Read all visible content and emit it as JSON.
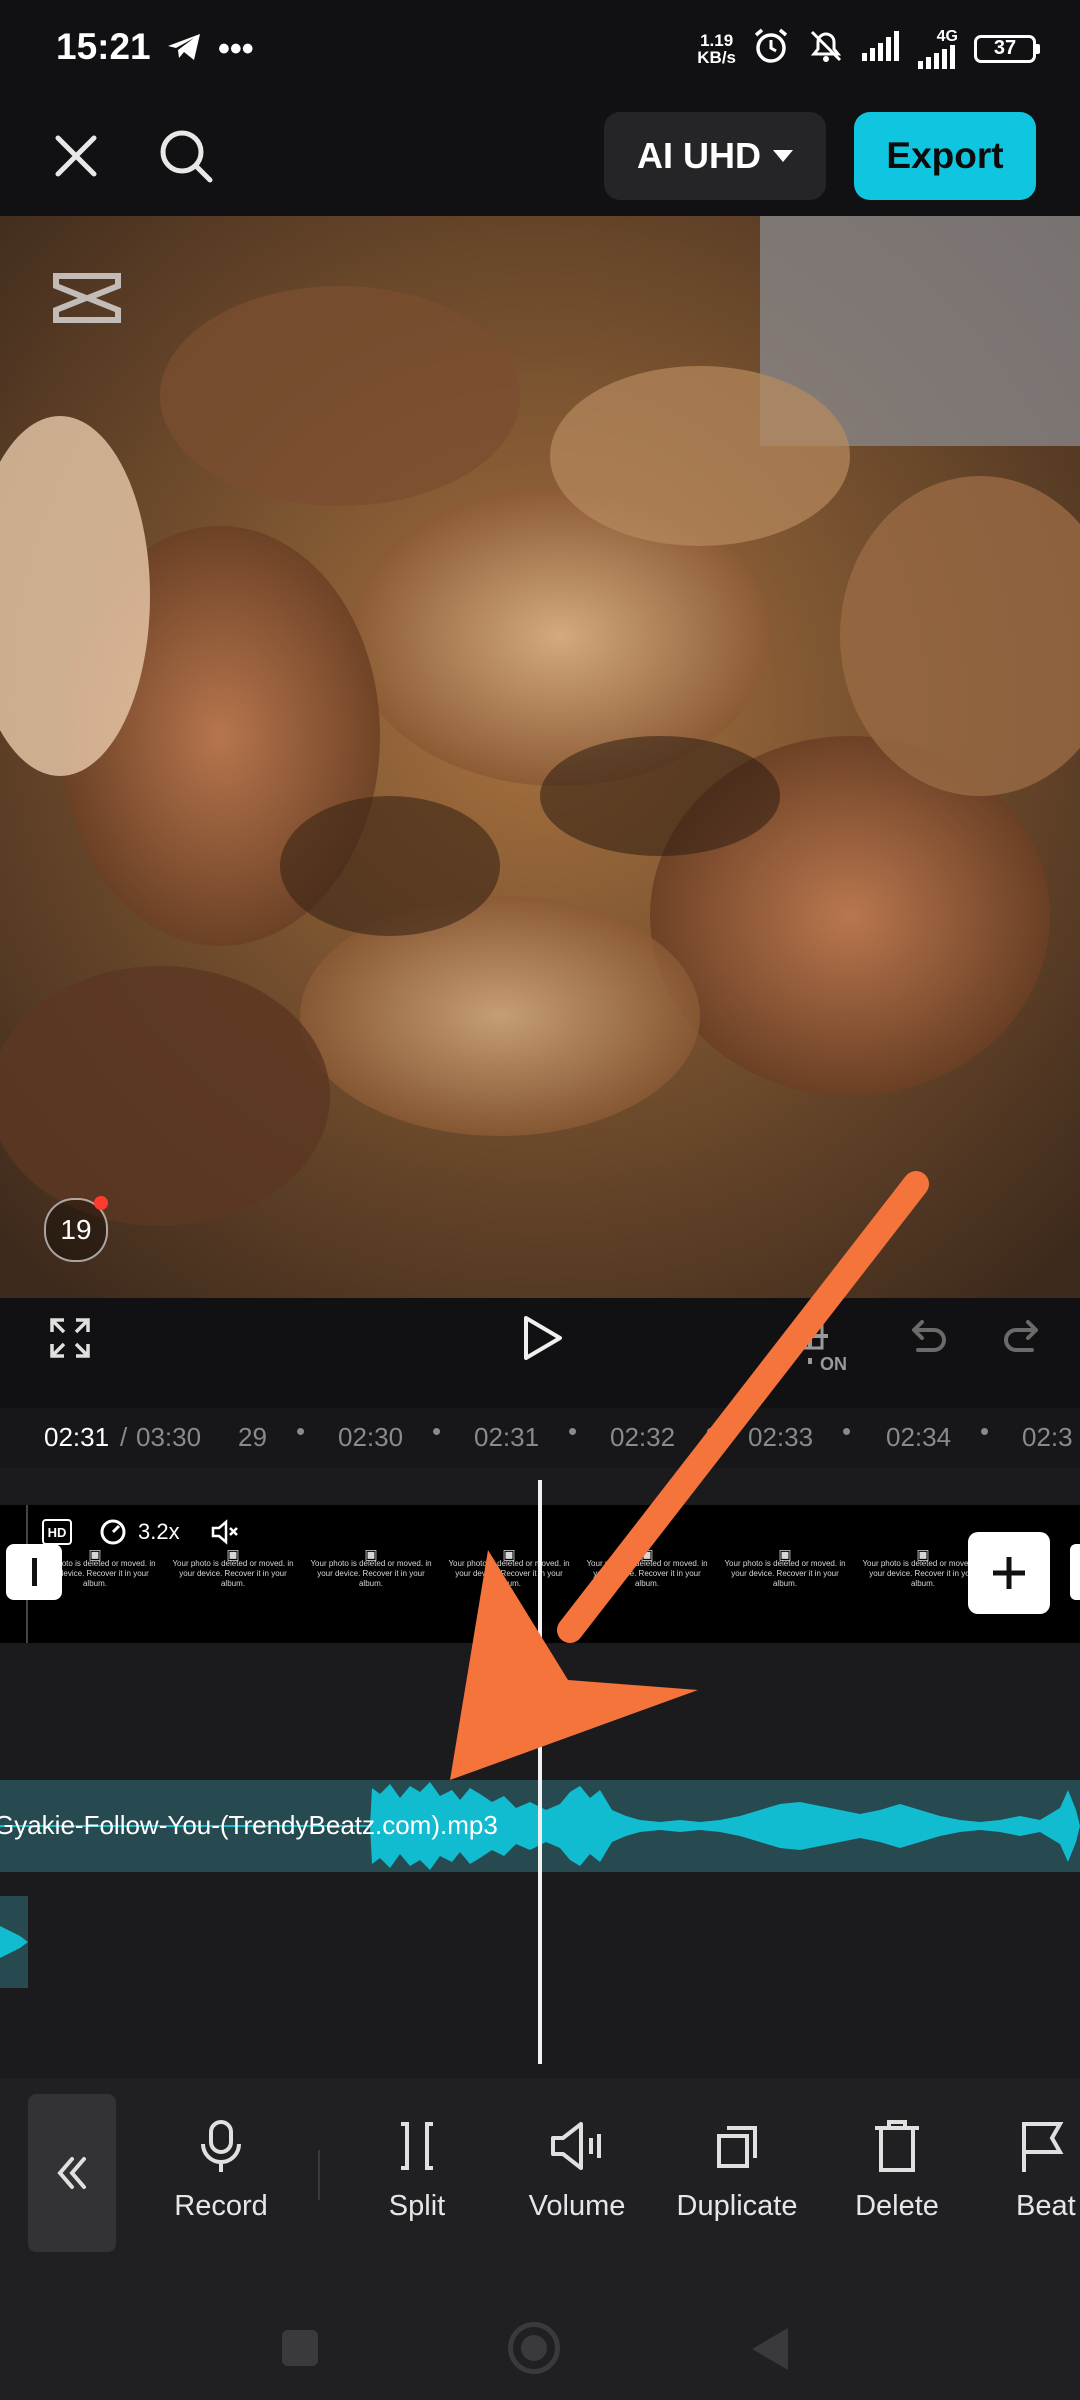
{
  "status_bar": {
    "time": "15:21",
    "net_speed_value": "1.19",
    "net_speed_unit": "KB/s",
    "network": "4G",
    "battery": "37"
  },
  "top_bar": {
    "quality_label": "AI UHD",
    "export_label": "Export"
  },
  "preview": {
    "watermark_icon": "capcut-logo-icon",
    "notification_count": "19"
  },
  "controls": {
    "fullscreen_icon": "fullscreen-icon",
    "play_icon": "play-icon",
    "keyframe_label": "ON",
    "undo_icon": "undo-icon",
    "redo_icon": "redo-icon"
  },
  "ruler": {
    "current_time": "02:31",
    "separator": "/",
    "total_time": "03:30",
    "ticks": [
      "29",
      "02:30",
      "02:31",
      "02:32",
      "02:33",
      "02:34",
      "02:3"
    ]
  },
  "video_track": {
    "hd_label": "HD",
    "speed_label": "3.2x",
    "thumb_caption": "Your photo is deleted or moved. in your device. Recover it in your album."
  },
  "audio_track": {
    "filename": "Gyakie-Follow-You-(TrendyBeatz.com).mp3"
  },
  "toolbar": {
    "items": [
      {
        "label": "Record",
        "icon": "microphone-icon"
      },
      {
        "label": "Split",
        "icon": "split-icon"
      },
      {
        "label": "Volume",
        "icon": "volume-icon"
      },
      {
        "label": "Duplicate",
        "icon": "duplicate-icon"
      },
      {
        "label": "Delete",
        "icon": "delete-icon"
      },
      {
        "label": "Beat",
        "icon": "beat-flag-icon"
      }
    ]
  },
  "colors": {
    "accent": "#10c5e0",
    "annotation_arrow": "#f4743b",
    "audio_wave": "#12bcd0"
  }
}
